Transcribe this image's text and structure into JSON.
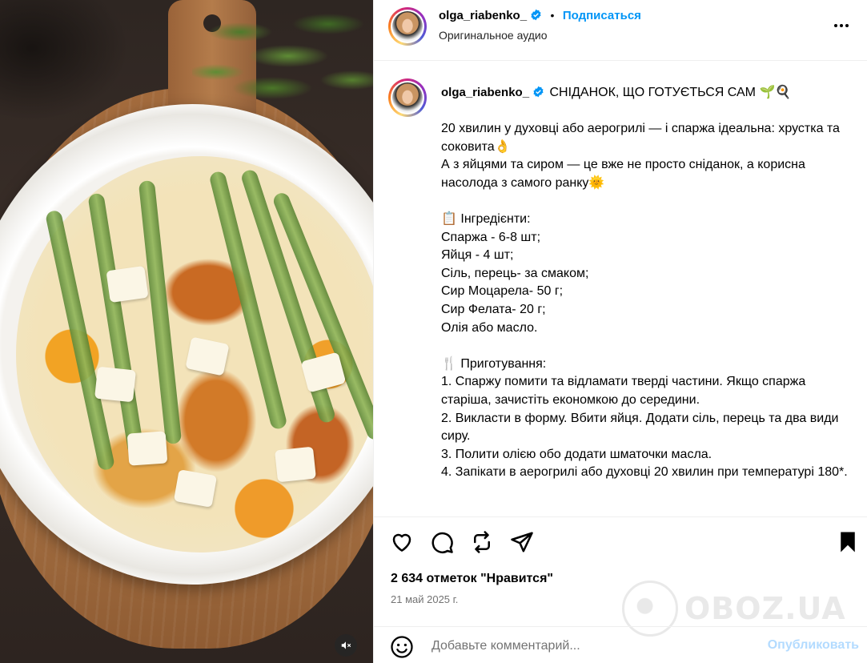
{
  "post_header": {
    "username": "olga_riabenko_",
    "separator": "•",
    "follow_label": "Подписаться",
    "audio": "Оригинальное аудио",
    "verified_color": "#0095f6"
  },
  "caption": {
    "username": "olga_riabenko_",
    "title": "СНІДАНОК, ЩО ГОТУЄТЬСЯ САМ",
    "title_emojis": "🌱🍳",
    "body": "20 хвилин у духовці або аерогрилі — і спаржа ідеальна: хрустка та соковита👌\nА з яйцями та сиром — це вже не просто сніданок, а корисна насолода з самого ранку🌞\n\n📋 Інгредієнти:\nСпаржа - 6-8 шт;\nЯйця - 4 шт;\nСіль, перець- за смаком;\nСир Моцарела- 50 г;\nСир Фелата- 20 г;\nОлія або масло.\n\n🍴 Приготування:\n1. Спаржу помити та відламати тверді частини. Якщо спаржа старіша, зачистіть економкою до середини.\n2. Викласти в форму. Вбити яйця. Додати сіль, перець та два види сиру.\n3. Полити олією обо додати шматочки масла.\n4. Запікати в аерогрилі або духовці 20 хвилин при температурі 180*."
  },
  "icons": {
    "like": "heart-icon",
    "comment": "comment-icon",
    "share": "repost-icon",
    "send": "send-icon",
    "save": "bookmark-icon",
    "more": "more-icon",
    "mute": "muted-speaker-icon",
    "emoji": "smiley-icon"
  },
  "stats": {
    "likes": "2 634 отметок \"Нравится\"",
    "date": "21 май 2025 г."
  },
  "watermark": {
    "text": "OBOZ.UA"
  },
  "comment_box": {
    "placeholder": "Добавьте комментарий...",
    "publish_label": "Опубликовать",
    "publish_color": "#b3dbff"
  },
  "media": {
    "description_kind": "video"
  }
}
